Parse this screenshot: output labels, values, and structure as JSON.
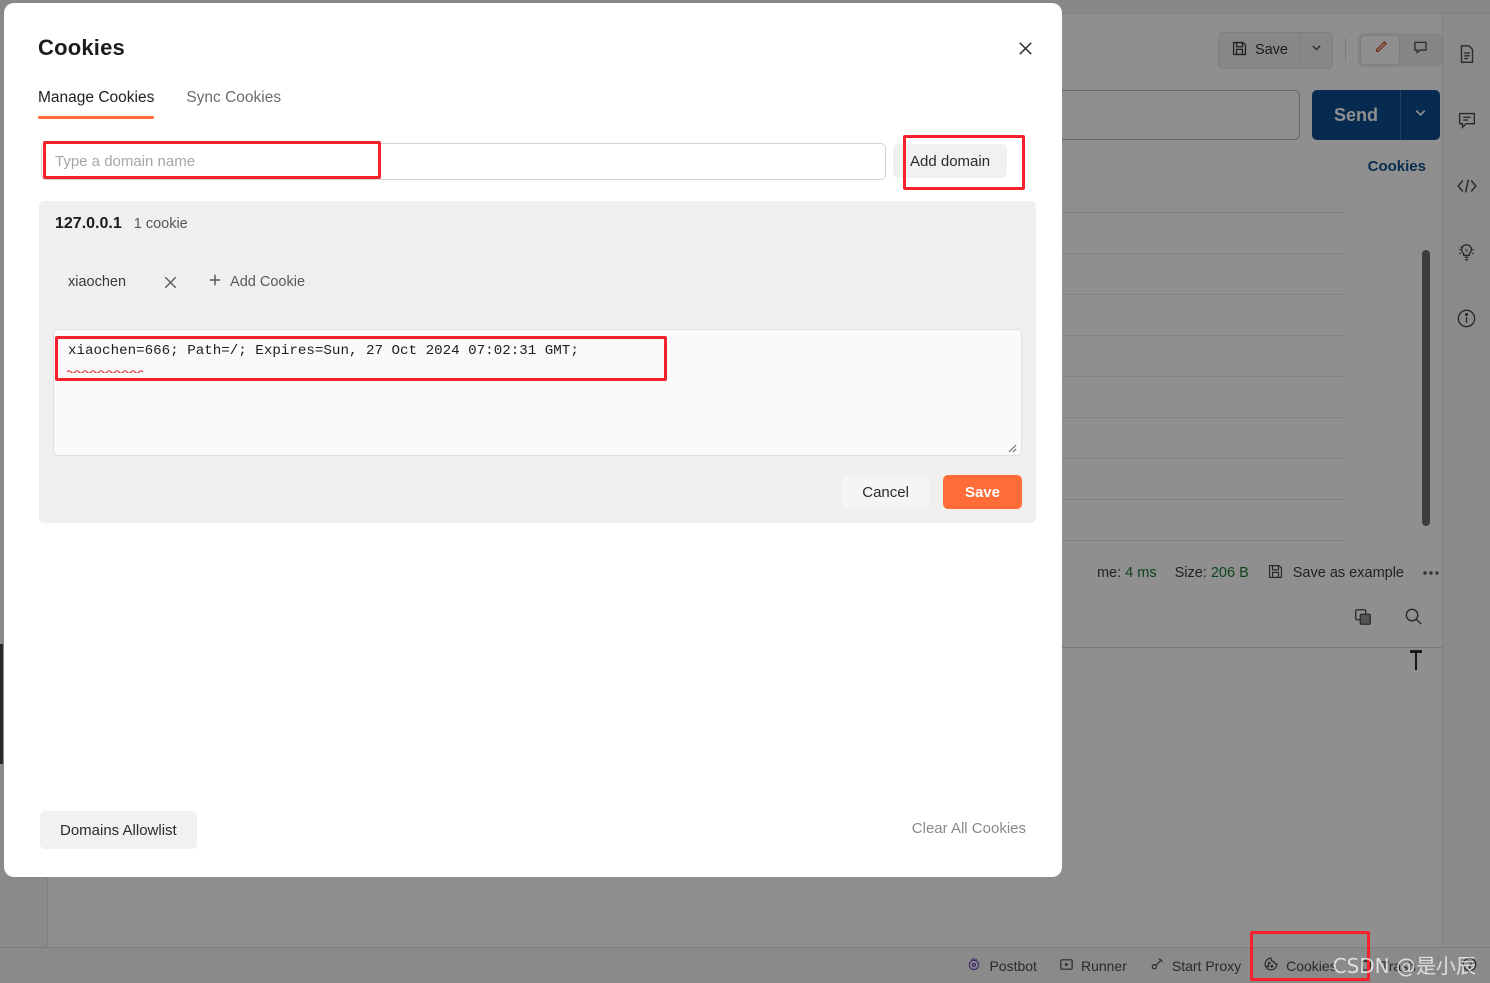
{
  "modal": {
    "title": "Cookies",
    "close_icon": "close-icon",
    "tabs": [
      {
        "label": "Manage Cookies",
        "active": true
      },
      {
        "label": "Sync Cookies",
        "active": false
      }
    ],
    "domain_input": {
      "value": "",
      "placeholder": "Type a domain name"
    },
    "add_domain_label": "Add domain",
    "domain_card": {
      "domain": "127.0.0.1",
      "cookie_count_label": "1 cookie",
      "cookie_name": "xiaochen",
      "delete_icon": "close-icon",
      "add_cookie_label": "Add Cookie",
      "add_cookie_icon": "plus-icon",
      "cookie_string": "xiaochen=666; Path=/; Expires=Sun, 27 Oct 2024 07:02:31 GMT;",
      "resize_icon": "resize-handle-icon",
      "cancel_label": "Cancel",
      "save_label": "Save"
    },
    "footer": {
      "allowlist_label": "Domains Allowlist",
      "clear_all_label": "Clear All Cookies"
    }
  },
  "background": {
    "toolbar": {
      "save_label": "Save",
      "save_icon": "floppy-disk-icon",
      "save_caret_icon": "chevron-down-icon",
      "edit_icon": "pencil-icon",
      "comment_icon": "comment-icon"
    },
    "request": {
      "send_label": "Send",
      "send_caret_icon": "chevron-down-icon",
      "cookies_link_label": "Cookies"
    },
    "response_meta": {
      "time_label": "me: ",
      "time_value": "4 ms",
      "size_label": "Size: ",
      "size_value": "206 B",
      "save_as_example_label": "Save as example",
      "save_as_example_icon": "floppy-disk-icon",
      "more_icon": "ellipsis-icon",
      "copy_icon": "copy-icon",
      "search_icon": "search-icon"
    },
    "right_rail_icons": [
      "document-icon",
      "comment-icon",
      "code-icon",
      "lightbulb-icon",
      "info-circle-icon"
    ],
    "status_bar": [
      {
        "label": "Postbot",
        "icon": "postbot-icon"
      },
      {
        "label": "Runner",
        "icon": "play-box-icon"
      },
      {
        "label": "Start Proxy",
        "icon": "proxy-icon"
      },
      {
        "label": "Cookies",
        "icon": "cookie-icon",
        "highlighted": true
      },
      {
        "label": "Trash",
        "icon": "trash-icon"
      },
      {
        "label": "",
        "icon": "help-circle-icon"
      }
    ]
  },
  "watermark": "CSDN @是小辰",
  "colors": {
    "accent_orange": "#ff6c37",
    "send_blue": "#0b4b8f",
    "link_blue": "#11508f",
    "highlight_red": "#f5222d",
    "meta_green": "#1a7a32"
  }
}
